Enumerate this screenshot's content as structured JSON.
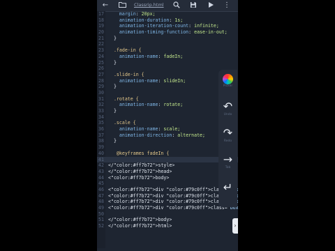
{
  "toolbar": {
    "filename": "Classrip.html",
    "icons": [
      "back-arrow-icon",
      "folder-icon",
      "search-icon",
      "save-icon",
      "play-icon",
      "more-icon"
    ]
  },
  "editor": {
    "active_line": 41,
    "lines": [
      {
        "n": "17",
        "text": "    margin: 20px;"
      },
      {
        "n": "18",
        "text": "    animation-duration: 1s;"
      },
      {
        "n": "19",
        "text": "    animation-iteration-count: infinite;"
      },
      {
        "n": "20",
        "text": "    animation-timing-function: ease-in-out;"
      },
      {
        "n": "21",
        "text": "  }"
      },
      {
        "n": "22",
        "text": ""
      },
      {
        "n": "23",
        "text": "  .fade-in {"
      },
      {
        "n": "24",
        "text": "    animation-name: fadeIn;"
      },
      {
        "n": "25",
        "text": "  }"
      },
      {
        "n": "26",
        "text": ""
      },
      {
        "n": "27",
        "text": "  .slide-in {"
      },
      {
        "n": "28",
        "text": "    animation-name: slideIn;"
      },
      {
        "n": "29",
        "text": "  }"
      },
      {
        "n": "30",
        "text": ""
      },
      {
        "n": "31",
        "text": "  .rotate {"
      },
      {
        "n": "32",
        "text": "    animation-name: rotate;"
      },
      {
        "n": "33",
        "text": "  }"
      },
      {
        "n": "34",
        "text": ""
      },
      {
        "n": "35",
        "text": "  .scale {"
      },
      {
        "n": "36",
        "text": "    animation-name: scale;"
      },
      {
        "n": "37",
        "text": "    animation-direction: alternate;"
      },
      {
        "n": "38",
        "text": "  }"
      },
      {
        "n": "39",
        "text": ""
      },
      {
        "n": "40",
        "text": "   @keyframes fadeIn {"
      },
      {
        "n": "41",
        "text": ""
      },
      {
        "n": "42",
        "text": "</style>"
      },
      {
        "n": "43",
        "text": "</head>"
      },
      {
        "n": "44",
        "text": "<body>"
      },
      {
        "n": "45",
        "text": ""
      },
      {
        "n": "46",
        "text": "<div class=\"box fade-in\">Fade In</div>"
      },
      {
        "n": "47",
        "text": "<div class=\"box slide-in\">Slide In</div>"
      },
      {
        "n": "48",
        "text": "<div class=\"box rotate\">Rotate</div>"
      },
      {
        "n": "49",
        "text": "<div class=\"box scale\">Scale</div>"
      },
      {
        "n": "50",
        "text": ""
      },
      {
        "n": "51",
        "text": "</body>"
      },
      {
        "n": "52",
        "text": "</html>"
      }
    ]
  },
  "side_panel": {
    "buttons": [
      {
        "name": "color-picker-button",
        "icon": "color-wheel-icon",
        "glyph": "",
        "label": "Picker"
      },
      {
        "name": "undo-button",
        "icon": "undo-icon",
        "glyph": "↶",
        "label": "Undo"
      },
      {
        "name": "redo-button",
        "icon": "redo-icon",
        "glyph": "↷",
        "label": "Redo"
      },
      {
        "name": "tab-button",
        "icon": "arrow-right-icon",
        "glyph": "→",
        "label": "Tab"
      },
      {
        "name": "enter-button",
        "icon": "enter-icon",
        "glyph": "↵",
        "label": ""
      }
    ]
  },
  "colors": {
    "background": "#1e2531",
    "text": "#dfe5ee",
    "selector": "#e3c78a",
    "property": "#7fb6e6",
    "value": "#c3e88d",
    "tag": "#ff7b72",
    "attr": "#79c0ff",
    "string": "#a5d6ff",
    "line_number": "#55627a"
  }
}
